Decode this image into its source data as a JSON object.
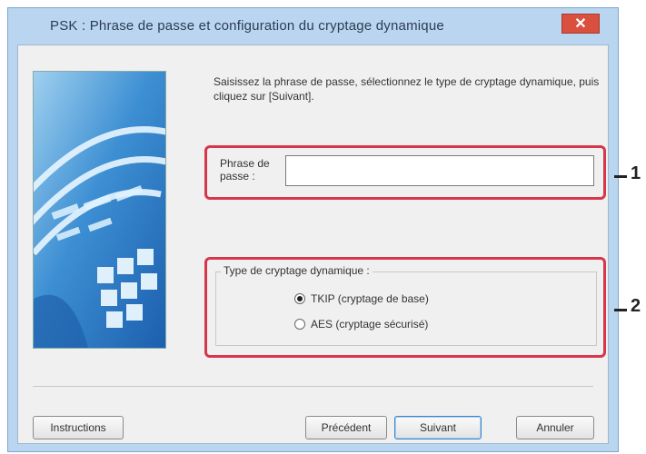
{
  "window": {
    "title": "PSK : Phrase de passe et configuration du cryptage dynamique",
    "close_glyph": "✕"
  },
  "instruction": "Saisissez la phrase de passe, sélectionnez le type de cryptage dynamique, puis cliquez sur [Suivant].",
  "passphrase": {
    "label": "Phrase de passe :",
    "value": "",
    "placeholder": ""
  },
  "encryption": {
    "group_title": "Type de cryptage dynamique :",
    "options": [
      {
        "label": "TKIP (cryptage de base)",
        "checked": true
      },
      {
        "label": "AES (cryptage sécurisé)",
        "checked": false
      }
    ]
  },
  "callouts": [
    "1",
    "2"
  ],
  "buttons": {
    "instructions": "Instructions",
    "previous": "Précédent",
    "next": "Suivant",
    "cancel": "Annuler"
  },
  "colors": {
    "highlight": "#d8364a",
    "title_bar": "#b9d5ef",
    "close_button": "#d9503f",
    "image_blue": "#2a79c4"
  },
  "icons": {
    "close": "close-icon",
    "side_image": "wireless-illustration-icon"
  }
}
